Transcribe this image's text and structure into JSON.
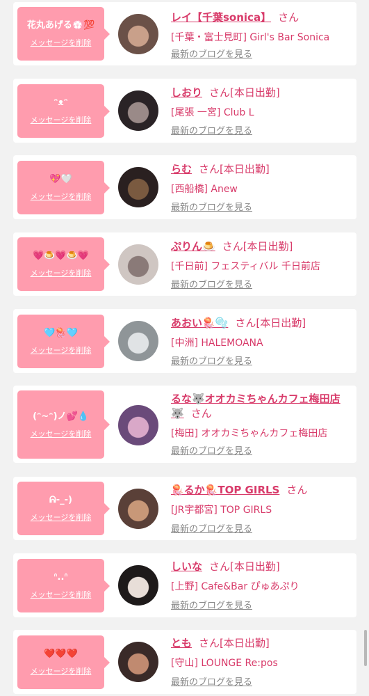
{
  "delete_label": "メッセージを削除",
  "blog_label": "最新のブログを見る",
  "san_label": "さん",
  "items": [
    {
      "message": "花丸あげる💮💯",
      "name": "レイ【千葉sonica】",
      "name2": "",
      "schedule": "",
      "shop": "[千葉・富士見町] Girl's Bar Sonica",
      "avatar_colors": [
        "#6b5148",
        "#c9a08a"
      ]
    },
    {
      "message": "ᵔᴥᵔ",
      "name": "しおり",
      "name2": "",
      "schedule": "[本日出勤]",
      "shop": "[尾張 一宮] Club L",
      "avatar_colors": [
        "#2a2326",
        "#9a8a88"
      ]
    },
    {
      "message": "💖🤍",
      "name": "らむ",
      "name2": "",
      "schedule": "[本日出勤]",
      "shop": "[西船橋] Anew",
      "avatar_colors": [
        "#2a2020",
        "#7a5a40"
      ]
    },
    {
      "message": "💗🍮💗🍮💗",
      "name": "ぷりん🍮",
      "name2": "",
      "schedule": "[本日出勤]",
      "shop": "[千日前] フェスティバル 千日前店",
      "avatar_colors": [
        "#cfc6c2",
        "#8a7a78"
      ]
    },
    {
      "message": "🩵🪼🩵",
      "name": "あおい🪼🫧",
      "name2": "",
      "schedule": "[本日出勤]",
      "shop": "[中洲] HALEMOANA",
      "avatar_colors": [
        "#8f9598",
        "#e0e3e5"
      ]
    },
    {
      "message": "(ᵔ~ᵔ)ノ💕💧",
      "name": "るな🐺オオカミちゃんカフェ梅田店",
      "name2": "🐺",
      "schedule": "",
      "shop": "[梅田] オオカミちゃんカフェ梅田店",
      "avatar_colors": [
        "#6a4a7a",
        "#d9a8c8"
      ]
    },
    {
      "message": "ᕱ-_-)",
      "name": "🪼るか🪼TOP GIRLS",
      "name2": "",
      "schedule": "",
      "shop": "[JR宇都宮] TOP GIRLS",
      "avatar_colors": [
        "#5a4038",
        "#c89878"
      ]
    },
    {
      "message": "ᐢ..ᐢ",
      "name": "しいな",
      "name2": "",
      "schedule": "[本日出勤]",
      "shop": "[上野] Cafe&Bar ぴゅあぷり",
      "avatar_colors": [
        "#1e1a1a",
        "#e8ded8"
      ]
    },
    {
      "message": "❤️❤️❤️",
      "name": "とも",
      "name2": "",
      "schedule": "[本日出勤]",
      "shop": "[守山] LOUNGE Re:pos",
      "avatar_colors": [
        "#3a2a28",
        "#c08a70"
      ]
    }
  ]
}
